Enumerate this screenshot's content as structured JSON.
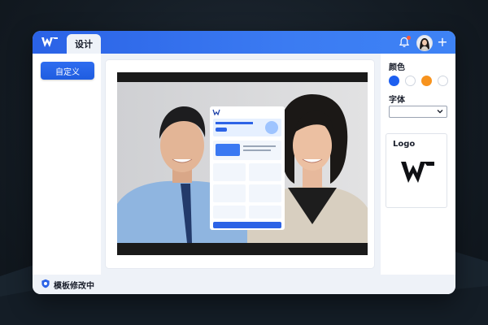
{
  "app": {
    "tab_label": "设计",
    "brand_color": "#2a62e6"
  },
  "left_panel": {
    "custom_button_label": "自定义"
  },
  "right_panel": {
    "color_section_title": "颜色",
    "colors": [
      {
        "name": "blue",
        "hex": "#1d5ff0"
      },
      {
        "name": "white",
        "hex": "#ffffff"
      },
      {
        "name": "orange",
        "hex": "#f7931e"
      },
      {
        "name": "white-2",
        "hex": "#ffffff"
      }
    ],
    "font_section_title": "字体",
    "font_select_value": "",
    "logo_section_title": "Logo"
  },
  "status_bar": {
    "text": "模板修改中"
  },
  "icons": [
    "wps-logo-icon",
    "bell-icon",
    "avatar",
    "plus-icon",
    "chevron-down-icon",
    "shield-icon"
  ]
}
